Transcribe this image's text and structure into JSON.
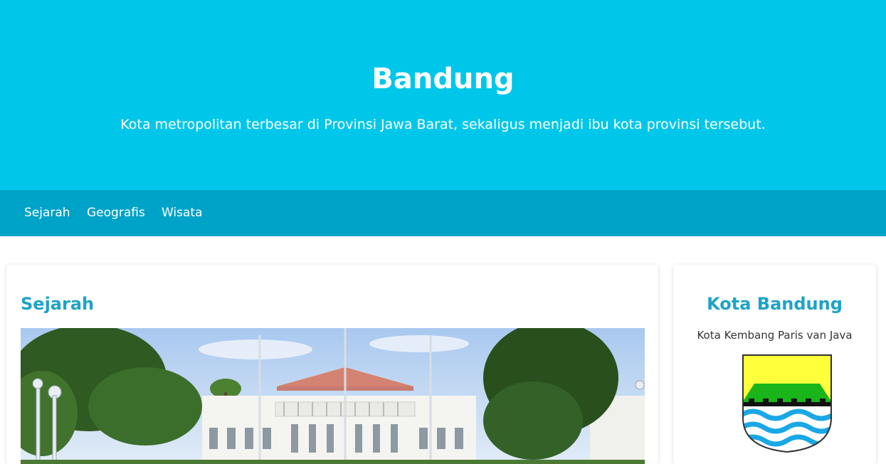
{
  "header": {
    "title": "Bandung",
    "subtitle": "Kota metropolitan terbesar di Provinsi Jawa Barat, sekaligus menjadi ibu kota provinsi tersebut."
  },
  "nav": {
    "items": [
      {
        "label": "Sejarah"
      },
      {
        "label": "Geografis"
      },
      {
        "label": "Wisata"
      }
    ]
  },
  "main": {
    "section_title": "Sejarah",
    "image": "gedung-sate-photo"
  },
  "aside": {
    "title": "Kota Bandung",
    "tagline": "Kota Kembang Paris van Java",
    "image": "bandung-coat-of-arms"
  },
  "colors": {
    "header_bg": "#00c7e9",
    "nav_bg": "#00a3c8",
    "accent": "#1ea3c7"
  }
}
